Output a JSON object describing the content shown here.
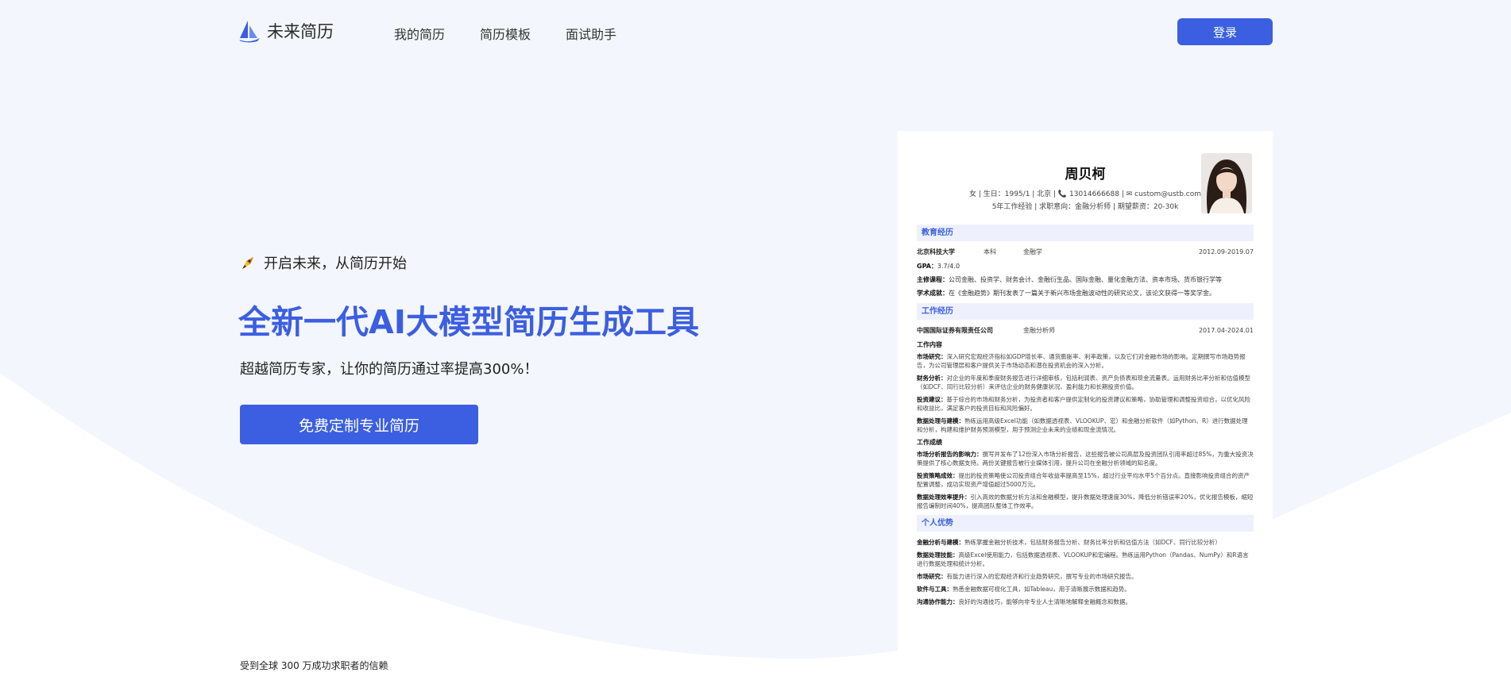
{
  "header": {
    "logo_text": "未来简历",
    "nav": [
      "我的简历",
      "简历模板",
      "面试助手"
    ],
    "login_label": "登录"
  },
  "hero": {
    "tagline": "开启未来，从简历开始",
    "headline": "全新一代AI大模型简历生成工具",
    "subline": "超越简历专家，让你的简历通过率提高300%！",
    "cta_label": "免费定制专业简历",
    "trust_text": "受到全球 300 万成功求职者的信赖"
  },
  "resume": {
    "name": "周贝柯",
    "info_line1": "女 | 生日：1995/1 | 北京 | 📞 13014666688 | ✉ custom@ustb.com",
    "info_line2": "5年工作经验 | 求职意向：金融分析师 | 期望薪资：20-30k",
    "education": {
      "title": "教育经历",
      "school": "北京科技大学",
      "degree": "本科",
      "major": "金融学",
      "date": "2012.09-2019.07",
      "gpa_label": "GPA：",
      "gpa": "3.7/4.0",
      "courses_label": "主修课程：",
      "courses": "公司金融、投资学、财务会计、金融衍生品、国际金融、量化金融方法、资本市场、货币银行学等",
      "award_label": "学术成就：",
      "award": "在《金融趋势》期刊发表了一篇关于新兴市场金融波动性的研究论文，该论文获得一等奖学金。"
    },
    "work": {
      "title": "工作经历",
      "company": "中国国际证券有限责任公司",
      "role": "金融分析师",
      "date": "2017.04-2024.01",
      "content_head": "工作内容",
      "items": [
        {
          "label": "市场研究：",
          "text": "深入研究宏观经济指标如GDP增长率、通货膨胀率、利率政策，以及它们对金融市场的影响。定期撰写市场趋势报告，为公司管理层和客户提供关于市场动态和潜在投资机会的深入分析。"
        },
        {
          "label": "财务分析：",
          "text": "对企业的年度和季度财务报告进行详细审核，包括利润表、资产负债表和现金流量表。运用财务比率分析和估值模型（如DCF、同行比较分析）来评估企业的财务健康状况、盈利能力和长期投资价值。"
        },
        {
          "label": "投资建议：",
          "text": "基于综合的市场和财务分析，为投资者和客户提供定制化的投资建议和策略，协助管理和调整投资组合，以优化风险和收益比，满足客户的投资目标和风险偏好。"
        },
        {
          "label": "数据处理与建模：",
          "text": "熟练运用高级Excel功能（如数据透视表、VLOOKUP、宏）和金融分析软件（如Python、R）进行数据处理和分析，构建和维护财务预测模型，用于预测企业未来的业绩和现金流情况。"
        }
      ],
      "results_head": "工作成绩",
      "results": [
        {
          "label": "市场分析报告的影响力：",
          "text": "撰写并发布了12份深入市场分析报告，这些报告被公司高层及投资团队引用率超过85%，为重大投资决策提供了核心数据支持。两份关键报告被行业媒体引用，提升公司在金融分析领域的知名度。"
        },
        {
          "label": "投资策略成效：",
          "text": "提出的投资策略使公司投资组合年收益率提高至15%，超过行业平均水平5个百分点。直接影响投资组合的资产配置调整，成功实现资产增值超过5000万元。"
        },
        {
          "label": "数据处理效率提升：",
          "text": "引入高效的数据分析方法和金融模型，提升数据处理速度30%，降低分析错误率20%，优化报告模板，缩短报告编制时间40%，提高团队整体工作效率。"
        }
      ]
    },
    "strengths": {
      "title": "个人优势",
      "items": [
        {
          "label": "金融分析与建模：",
          "text": "熟练掌握金融分析技术，包括财务报告分析、财务比率分析和估值方法（如DCF、同行比较分析）"
        },
        {
          "label": "数据处理技能：",
          "text": "高级Excel使用能力，包括数据透视表、VLOOKUP和宏编程。熟练运用Python（Pandas、NumPy）和R语言进行数据处理和统计分析。"
        },
        {
          "label": "市场研究：",
          "text": "有能力进行深入的宏观经济和行业趋势研究，撰写专业的市场研究报告。"
        },
        {
          "label": "软件与工具：",
          "text": "熟悉金融数据可视化工具，如Tableau，用于清晰展示数据和趋势。"
        },
        {
          "label": "沟通协作能力：",
          "text": "良好的沟通技巧，能够向非专业人士清晰地解释金融概念和数据。"
        }
      ]
    }
  }
}
